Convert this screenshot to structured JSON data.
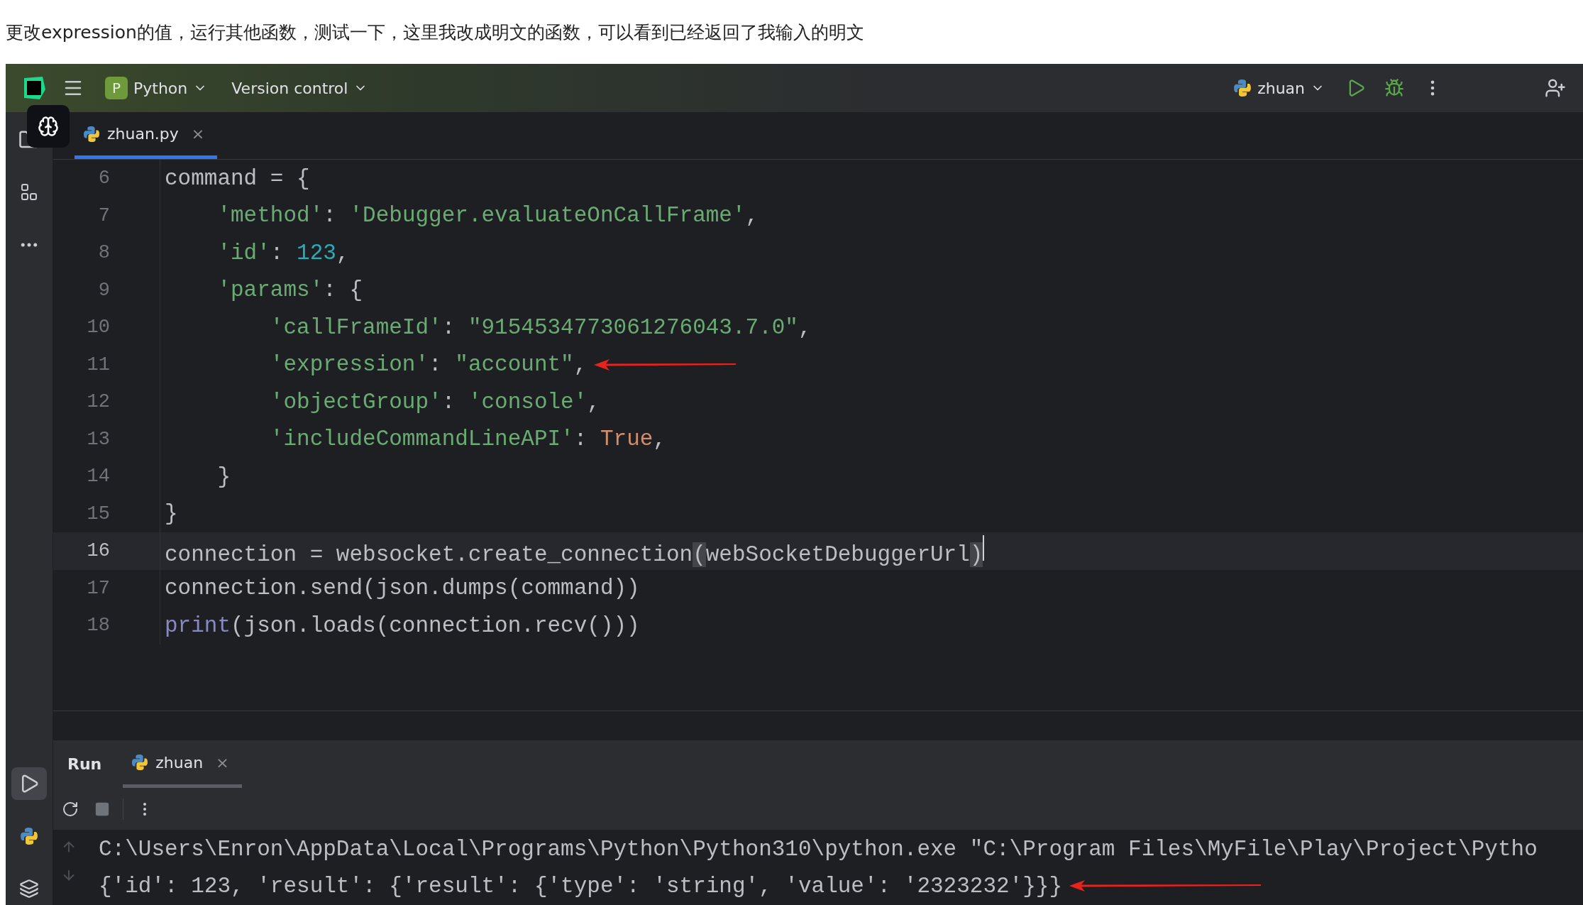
{
  "caption": "更改expression的值，运行其他函数，测试一下，这里我改成明文的函数，可以看到已经返回了我输入的明文",
  "toolbar": {
    "project_badge": "P",
    "project": "Python",
    "vcs": "Version control",
    "run_config": "zhuan"
  },
  "editor_tabs": [
    {
      "label": "zhuan.py",
      "close": "×",
      "selected": true
    }
  ],
  "code_lines": [
    {
      "number": "6",
      "current": false,
      "arrow": false,
      "tokens": [
        {
          "kind": "plain",
          "text": "command = {"
        }
      ]
    },
    {
      "number": "7",
      "current": false,
      "arrow": false,
      "tokens": [
        {
          "kind": "string",
          "text": "    'method'"
        },
        {
          "kind": "plain",
          "text": ": "
        },
        {
          "kind": "string",
          "text": "'Debugger.evaluateOnCallFrame'"
        },
        {
          "kind": "plain",
          "text": ","
        }
      ]
    },
    {
      "number": "8",
      "current": false,
      "arrow": false,
      "tokens": [
        {
          "kind": "string",
          "text": "    'id'"
        },
        {
          "kind": "plain",
          "text": ": "
        },
        {
          "kind": "number",
          "text": "123"
        },
        {
          "kind": "plain",
          "text": ","
        }
      ]
    },
    {
      "number": "9",
      "current": false,
      "arrow": false,
      "tokens": [
        {
          "kind": "string",
          "text": "    'params'"
        },
        {
          "kind": "plain",
          "text": ": {"
        }
      ]
    },
    {
      "number": "10",
      "current": false,
      "arrow": false,
      "tokens": [
        {
          "kind": "string",
          "text": "        'callFrameId'"
        },
        {
          "kind": "plain",
          "text": ": "
        },
        {
          "kind": "string",
          "text": "\"9154534773061276043.7.0\""
        },
        {
          "kind": "plain",
          "text": ","
        }
      ]
    },
    {
      "number": "11",
      "current": false,
      "arrow": true,
      "tokens": [
        {
          "kind": "string",
          "text": "        'expression'"
        },
        {
          "kind": "plain",
          "text": ": "
        },
        {
          "kind": "string",
          "text": "\"account\""
        },
        {
          "kind": "plain",
          "text": ","
        }
      ]
    },
    {
      "number": "12",
      "current": false,
      "arrow": false,
      "tokens": [
        {
          "kind": "string",
          "text": "        'objectGroup'"
        },
        {
          "kind": "plain",
          "text": ": "
        },
        {
          "kind": "string",
          "text": "'console'"
        },
        {
          "kind": "plain",
          "text": ","
        }
      ]
    },
    {
      "number": "13",
      "current": false,
      "arrow": false,
      "tokens": [
        {
          "kind": "string",
          "text": "        'includeCommandLineAPI'"
        },
        {
          "kind": "plain",
          "text": ": "
        },
        {
          "kind": "keyword",
          "text": "True"
        },
        {
          "kind": "plain",
          "text": ","
        }
      ]
    },
    {
      "number": "14",
      "current": false,
      "arrow": false,
      "tokens": [
        {
          "kind": "plain",
          "text": "    }"
        }
      ]
    },
    {
      "number": "15",
      "current": false,
      "arrow": false,
      "tokens": [
        {
          "kind": "plain",
          "text": "}"
        }
      ]
    },
    {
      "number": "16",
      "current": true,
      "arrow": false,
      "tokens": [
        {
          "kind": "plain",
          "text": "connection = websocket.create_connection"
        },
        {
          "kind": "bracket",
          "text": "("
        },
        {
          "kind": "plain",
          "text": "webSocketDebuggerUrl"
        },
        {
          "kind": "bracket",
          "text": ")"
        }
      ]
    },
    {
      "number": "17",
      "current": false,
      "arrow": false,
      "tokens": [
        {
          "kind": "plain",
          "text": "connection.send(json.dumps(command))"
        }
      ]
    },
    {
      "number": "18",
      "current": false,
      "arrow": false,
      "tokens": [
        {
          "kind": "builtin",
          "text": "print"
        },
        {
          "kind": "plain",
          "text": "(json.loads(connection.recv()))"
        }
      ]
    }
  ],
  "run_panel": {
    "title": "Run",
    "tabs": [
      {
        "label": "zhuan",
        "close": "×",
        "selected": true
      }
    ],
    "output": [
      {
        "text": "C:\\Users\\Enron\\AppData\\Local\\Programs\\Python\\Python310\\python.exe \"C:\\Program Files\\MyFile\\Play\\Project\\Pytho",
        "arrow": false
      },
      {
        "text": "{'id': 123, 'result': {'result': {'type': 'string', 'value': '2323232'}}}",
        "arrow": true
      }
    ]
  }
}
